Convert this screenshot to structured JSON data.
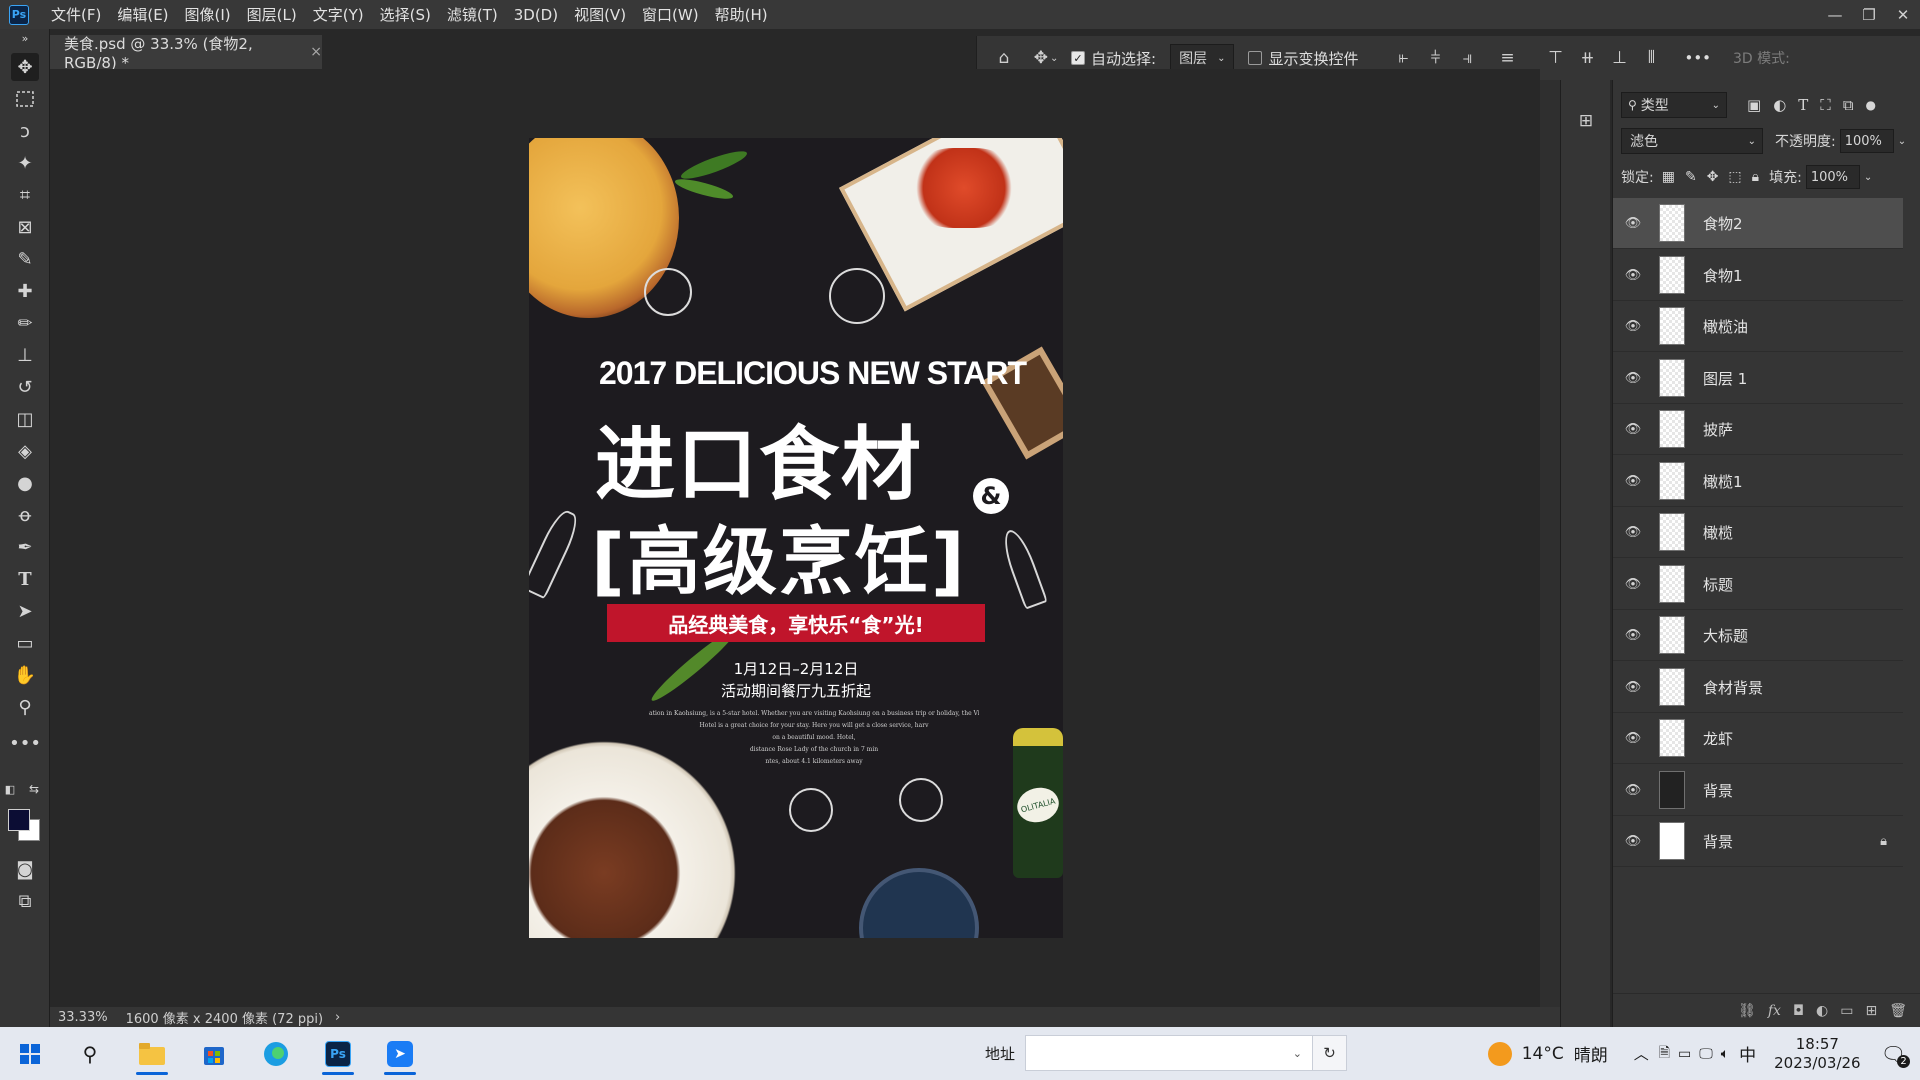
{
  "app": {
    "logo": "Ps"
  },
  "menu": [
    "文件(F)",
    "编辑(E)",
    "图像(I)",
    "图层(L)",
    "文字(Y)",
    "选择(S)",
    "滤镜(T)",
    "3D(D)",
    "视图(V)",
    "窗口(W)",
    "帮助(H)"
  ],
  "window_controls": {
    "minimize": "—",
    "restore": "❐",
    "close": "✕"
  },
  "document_tab": {
    "title": "美食.psd @ 33.3% (食物2, RGB/8) *",
    "close": "×"
  },
  "options_bar": {
    "auto_select_label": "自动选择:",
    "auto_select_checked": true,
    "auto_select_target": "图层",
    "show_transform_label": "显示变换控件",
    "show_transform_checked": false,
    "more": "•••",
    "mode_3d_label": "3D 模式:"
  },
  "poster": {
    "headline_en": "2017 DELICIOUS NEW START",
    "headline_cn_1": "进口食材",
    "amp": "&",
    "headline_cn_2": "[高级烹饪]",
    "banner": "品经典美食，享快乐“食”光!",
    "date_range": "1月12日–2月12日",
    "promo": "活动期间餐厅九五折起",
    "body_lines": [
      "ation in Kaohsiung, is a 5-star hotel. Whether you are visiting Kaohsiung on a business trip or holiday, the Vi",
      "Hotel is a great choice for your stay. Here you will get a close service, harv",
      "on a beautiful mood. Hotel,",
      "distance Rose Lady of the church in 7 min",
      "ntes, about 4.1 kilometers away"
    ],
    "bottle_label": "OLITALIA"
  },
  "layers_panel": {
    "filter_kind": "类型",
    "blend_mode": "滤色",
    "opacity_label": "不透明度:",
    "opacity": "100%",
    "lock_label": "锁定:",
    "fill_label": "填充:",
    "fill": "100%",
    "layers": [
      {
        "name": "食物2",
        "selected": true,
        "thumb": "transparent"
      },
      {
        "name": "食物1",
        "selected": false,
        "thumb": "transparent"
      },
      {
        "name": "橄榄油",
        "selected": false,
        "thumb": "transparent"
      },
      {
        "name": "图层 1",
        "selected": false,
        "thumb": "transparent"
      },
      {
        "name": "披萨",
        "selected": false,
        "thumb": "transparent"
      },
      {
        "name": "橄榄1",
        "selected": false,
        "thumb": "transparent"
      },
      {
        "name": "橄榄",
        "selected": false,
        "thumb": "transparent"
      },
      {
        "name": "标题",
        "selected": false,
        "thumb": "transparent"
      },
      {
        "name": "大标题",
        "selected": false,
        "thumb": "transparent"
      },
      {
        "name": "食材背景",
        "selected": false,
        "thumb": "transparent"
      },
      {
        "name": "龙虾",
        "selected": false,
        "thumb": "transparent"
      },
      {
        "name": "背景",
        "selected": false,
        "thumb": "dark"
      },
      {
        "name": "背景",
        "selected": false,
        "thumb": "white",
        "locked": true
      }
    ]
  },
  "status_bar": {
    "zoom": "33.33%",
    "doc_info": "1600 像素 x 2400 像素 (72 ppi)",
    "arrow": "›"
  },
  "taskbar": {
    "address_label": "地址",
    "weather_temp": "14°C",
    "weather_text": "晴朗",
    "ime": "中",
    "time": "18:57",
    "date": "2023/03/26",
    "notification_count": "2"
  },
  "colors": {
    "foreground": "#0c0d34",
    "background": "#ffffff",
    "banner_red": "#c0152b",
    "ui_dark": "#353535"
  }
}
